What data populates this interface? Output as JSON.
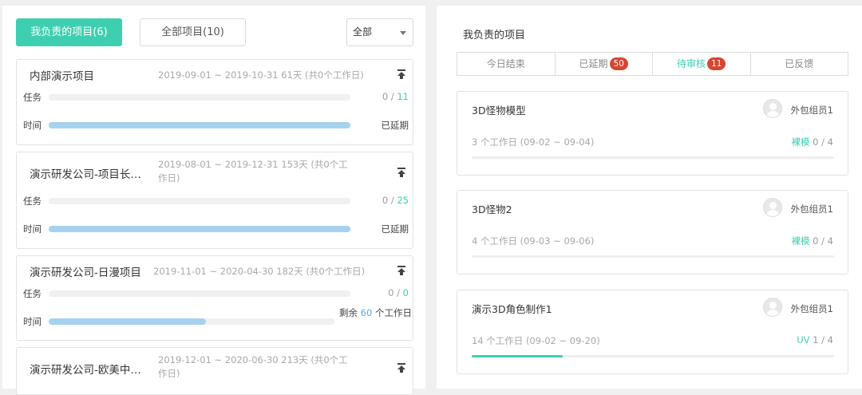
{
  "left": {
    "tab_mine": "我负责的项目(6)",
    "tab_all": "全部项目(10)",
    "filter_value": "全部",
    "projects": [
      {
        "title": "内部演示项目",
        "dates": "2019-09-01 ~ 2019-10-31 61天 (共0个工作日)",
        "task_label": "任务",
        "task_done": "0",
        "task_sep": " / ",
        "task_total": "11",
        "task_progress": 0,
        "time_label": "时间",
        "time_status": "已延期",
        "time_progress": 1.0
      },
      {
        "title": "演示研发公司-项目长…",
        "dates": "2019-08-01 ~ 2019-12-31 153天 (共0个工作日)",
        "task_label": "任务",
        "task_done": "0",
        "task_sep": " / ",
        "task_total": "25",
        "task_progress": 0,
        "time_label": "时间",
        "time_status": "已延期",
        "time_progress": 1.0
      },
      {
        "title": "演示研发公司-日漫项目",
        "dates": "2019-11-01 ~ 2020-04-30 182天 (共0个工作日)",
        "task_label": "任务",
        "task_done": "0",
        "task_sep": " / ",
        "task_total": "0",
        "task_progress": 0,
        "time_label": "时间",
        "remain_prefix": "剩余 ",
        "remain_num": "60",
        "remain_suffix": " 个工作日",
        "time_progress": 0.52
      },
      {
        "title": "演示研发公司-欧美中…",
        "dates": "2019-12-01 ~ 2020-06-30 213天 (共0个工作日)"
      }
    ]
  },
  "right": {
    "title": "我负责的项目",
    "tabs": [
      {
        "label": "今日结束",
        "badge": ""
      },
      {
        "label": "已延期",
        "badge": "50"
      },
      {
        "label": "待审核",
        "badge": "11"
      },
      {
        "label": "已反馈",
        "badge": ""
      }
    ],
    "tasks": [
      {
        "name": "3D怪物模型",
        "assignee": "外包组员1",
        "meta": "3 个工作日 (09-02 ~ 09-04)",
        "stage": "裸模",
        "progress": "0 / 4",
        "progress_fraction": 0
      },
      {
        "name": "3D怪物2",
        "assignee": "外包组员1",
        "meta": "4 个工作日 (09-03 ~ 09-06)",
        "stage": "裸模",
        "progress": "0 / 4",
        "progress_fraction": 0
      },
      {
        "name": "演示3D角色制作1",
        "assignee": "外包组员1",
        "meta": "14 个工作日 (09-02 ~ 09-20)",
        "stage": "UV",
        "progress": "1 / 4",
        "progress_fraction": 0.25
      }
    ]
  },
  "colors": {
    "accent": "#3ecfb0",
    "badge": "#d64531",
    "time_bar": "#a6d2f0",
    "remain_num": "#5aa9e6"
  }
}
